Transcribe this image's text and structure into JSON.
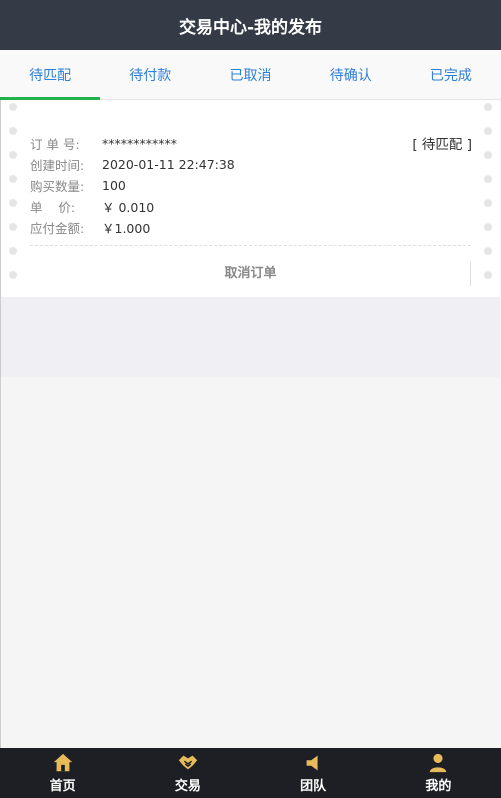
{
  "header": {
    "title": "交易中心-我的发布"
  },
  "tabs": [
    {
      "label": "待匹配",
      "active": true
    },
    {
      "label": "待付款",
      "active": false
    },
    {
      "label": "已取消",
      "active": false
    },
    {
      "label": "待确认",
      "active": false
    },
    {
      "label": "已完成",
      "active": false
    }
  ],
  "order": {
    "status": "[ 待匹配 ]",
    "fields": [
      {
        "label": "订 单 号:",
        "value": "************"
      },
      {
        "label": "创建时间:",
        "value": "2020-01-11 22:47:38"
      },
      {
        "label": "购买数量:",
        "value": "100"
      },
      {
        "label": "单    价:",
        "value": "￥ 0.010"
      },
      {
        "label": "应付金额:",
        "value": "￥1.000"
      }
    ],
    "cancel_label": "取消订单"
  },
  "bottom_nav": [
    {
      "label": "首页",
      "icon": "home-icon"
    },
    {
      "label": "交易",
      "icon": "handshake-icon"
    },
    {
      "label": "团队",
      "icon": "megaphone-icon"
    },
    {
      "label": "我的",
      "icon": "user-icon"
    }
  ],
  "colors": {
    "header_bg": "#343a46",
    "tab_text": "#2e7fd6",
    "tab_indicator": "#22b14c",
    "nav_bg": "#1e1f24",
    "nav_icon": "#e8bb5a"
  }
}
